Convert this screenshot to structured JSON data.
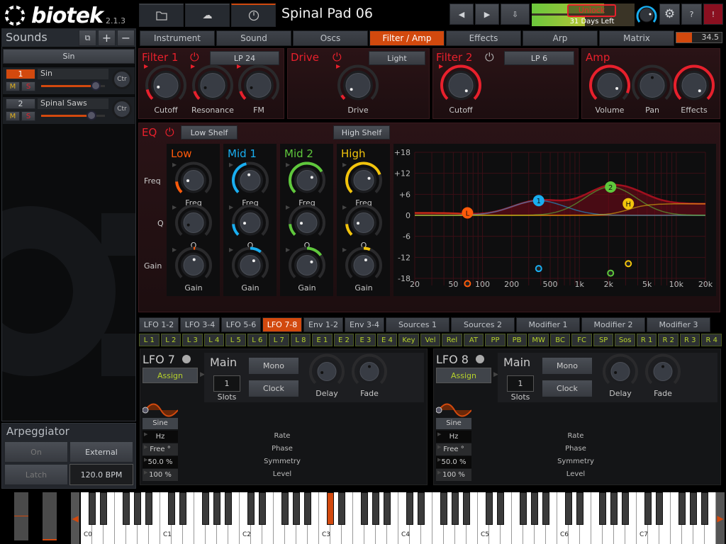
{
  "app": {
    "logo": "biotek",
    "version": "2.1.3"
  },
  "topbar": {
    "icons": [
      "folder-icon",
      "cloud-icon",
      "clock-icon"
    ],
    "preset_name": "Spinal Pad 06",
    "unlock": "Unlock",
    "days_left": "31 Days Left",
    "help": "?",
    "alert": "!",
    "cpu_value": "34.5",
    "cpu_fraction": 0.35
  },
  "main_tabs": [
    {
      "label": "Instrument"
    },
    {
      "label": "Sound"
    },
    {
      "label": "Oscs"
    },
    {
      "label": "Filter / Amp",
      "active": true
    },
    {
      "label": "Effects"
    },
    {
      "label": "Arp"
    },
    {
      "label": "Matrix"
    }
  ],
  "sounds": {
    "title": "Sounds",
    "selected": "Sin",
    "items": [
      {
        "num": "1",
        "name": "Sin",
        "level": 0.85,
        "active": true,
        "pan": "Ctr"
      },
      {
        "num": "2",
        "name": "Spinal Saws",
        "level": 0.79,
        "active": false,
        "pan": "Ctr"
      }
    ],
    "mute": "M",
    "solo": "S"
  },
  "arp": {
    "title": "Arpeggiator",
    "on": "On",
    "external": "External",
    "latch": "Latch",
    "bpm": "120.0 BPM"
  },
  "filter1": {
    "title": "Filter 1",
    "type": "LP 24",
    "knobs": [
      {
        "label": "Cutoff",
        "value": 0.12,
        "color": "#e8202c",
        "mod": true
      },
      {
        "label": "Resonance",
        "value": 0.1,
        "color": "#e8202c",
        "mod": true,
        "dark": true
      },
      {
        "label": "FM",
        "value": 0.1,
        "color": "#e8202c",
        "mod": true,
        "dark": true
      }
    ]
  },
  "drive": {
    "title": "Drive",
    "type": "Light",
    "knobs": [
      {
        "label": "Drive",
        "value": 0.05,
        "color": "#e8202c",
        "mod": true
      }
    ]
  },
  "filter2": {
    "title": "Filter 2",
    "type": "LP 6",
    "knobs": [
      {
        "label": "Cutoff",
        "value": 1.0,
        "color": "#e8202c",
        "mod": true
      }
    ]
  },
  "amp": {
    "title": "Amp",
    "knobs": [
      {
        "label": "Volume",
        "value": 0.92,
        "color": "#e8202c"
      },
      {
        "label": "Pan",
        "value": 0.5,
        "color": "#e8202c",
        "bipolar": true,
        "dark": true
      },
      {
        "label": "Effects",
        "value": 1.0,
        "color": "#e8202c"
      }
    ]
  },
  "eq": {
    "title": "EQ",
    "low_shelf": "Low Shelf",
    "high_shelf": "High Shelf",
    "row_labels": [
      "Freq",
      "Q",
      "Gain"
    ],
    "bands": [
      {
        "name": "Low",
        "color": "#ff5a0a",
        "knobs": [
          {
            "label": "Freq",
            "value": 0.15
          },
          {
            "label": "Q",
            "value": 0.08,
            "dark": true,
            "noarc": true
          },
          {
            "label": "Gain",
            "value": 0.52,
            "bipolar": true
          }
        ]
      },
      {
        "name": "Mid 1",
        "color": "#19aef0",
        "knobs": [
          {
            "label": "Freq",
            "value": 0.45
          },
          {
            "label": "Q",
            "value": 0.15
          },
          {
            "label": "Gain",
            "value": 0.64,
            "bipolar": true
          }
        ]
      },
      {
        "name": "Mid 2",
        "color": "#5fc83c",
        "knobs": [
          {
            "label": "Freq",
            "value": 0.72
          },
          {
            "label": "Q",
            "value": 0.15
          },
          {
            "label": "Gain",
            "value": 0.7,
            "bipolar": true
          }
        ]
      },
      {
        "name": "High",
        "color": "#f2c40c",
        "knobs": [
          {
            "label": "Freq",
            "value": 0.76
          },
          {
            "label": "Q",
            "value": 0.15
          },
          {
            "label": "Gain",
            "value": 0.58,
            "bipolar": true
          }
        ]
      }
    ]
  },
  "chart_data": {
    "type": "line",
    "title": "EQ response",
    "xscale": "log",
    "xlim": [
      20,
      20000
    ],
    "ylim": [
      -18,
      18
    ],
    "y_ticks": [
      "+18",
      "+12",
      "+6",
      "0",
      "-6",
      "-12",
      "-18"
    ],
    "y_tick_values": [
      18,
      12,
      6,
      0,
      -6,
      -12,
      -18
    ],
    "x_ticks": [
      "20",
      "50",
      "100",
      "200",
      "500",
      "1k",
      "2k",
      "5k",
      "10k",
      "20k"
    ],
    "x_tick_values": [
      20,
      50,
      100,
      200,
      500,
      1000,
      2000,
      5000,
      10000,
      20000
    ],
    "nodes": [
      {
        "label": "L",
        "freq": 70,
        "gain": 0.7,
        "q_db": -19.5,
        "color": "#ff5a0a",
        "type": "lowshelf"
      },
      {
        "label": "1",
        "freq": 380,
        "gain": 4.2,
        "q_db": -15.2,
        "color": "#19aef0",
        "type": "peak"
      },
      {
        "label": "2",
        "freq": 2100,
        "gain": 8.1,
        "q_db": -16.5,
        "color": "#5fc83c",
        "type": "peak"
      },
      {
        "label": "H",
        "freq": 3200,
        "gain": 3.3,
        "q_db": -13.8,
        "color": "#f2c40c",
        "type": "highshelf"
      }
    ]
  },
  "mod_tabs": [
    {
      "label": "LFO 1-2"
    },
    {
      "label": "LFO 3-4"
    },
    {
      "label": "LFO 5-6"
    },
    {
      "label": "LFO 7-8",
      "active": true
    },
    {
      "label": "Env 1-2"
    },
    {
      "label": "Env 3-4"
    },
    {
      "label": "Sources 1"
    },
    {
      "label": "Sources 2"
    },
    {
      "label": "Modifier 1"
    },
    {
      "label": "Modifier 2"
    },
    {
      "label": "Modifier 3"
    }
  ],
  "sources": [
    "L 1",
    "L 2",
    "L 3",
    "L 4",
    "L 5",
    "L 6",
    "L 7",
    "L 8",
    "E 1",
    "E 2",
    "E 3",
    "E 4",
    "Key",
    "Vel",
    "Rel",
    "AT",
    "PP",
    "PB",
    "MW",
    "BC",
    "FC",
    "SP",
    "Sos",
    "R 1",
    "R 2",
    "R 3",
    "R 4"
  ],
  "lfos": [
    {
      "title": "LFO 7",
      "assign": "Assign",
      "main": "Main",
      "slots": "1",
      "slots_label": "Slots",
      "mono": "Mono",
      "clock": "Clock",
      "knobs": [
        {
          "label": "Delay",
          "value": 0.12,
          "dark": true,
          "noarc": true
        },
        {
          "label": "Fade",
          "value": 0.5,
          "dark": true,
          "noarc": true
        }
      ],
      "wave": "Sine",
      "params": [
        {
          "value": "Hz",
          "label": "Rate"
        },
        {
          "value": "Free °",
          "label": "Phase"
        },
        {
          "value": "50.0 %",
          "label": "Symmetry"
        },
        {
          "value": "100 %",
          "label": "Level"
        }
      ]
    },
    {
      "title": "LFO 8",
      "assign": "Assign",
      "main": "Main",
      "slots": "1",
      "slots_label": "Slots",
      "mono": "Mono",
      "clock": "Clock",
      "knobs": [
        {
          "label": "Delay",
          "value": 0.12,
          "dark": true,
          "noarc": true
        },
        {
          "label": "Fade",
          "value": 0.5,
          "dark": true,
          "noarc": true
        }
      ],
      "wave": "Sine",
      "params": [
        {
          "value": "Hz",
          "label": "Rate"
        },
        {
          "value": "Free °",
          "label": "Phase"
        },
        {
          "value": "50.0 %",
          "label": "Symmetry"
        },
        {
          "value": "100 %",
          "label": "Level"
        }
      ]
    }
  ],
  "keyboard": {
    "octave_labels": [
      "C0",
      "C1",
      "C2",
      "C3",
      "C4",
      "C5",
      "C6",
      "C7"
    ],
    "pressed_key": "C#3",
    "accent": "#d2490e"
  }
}
